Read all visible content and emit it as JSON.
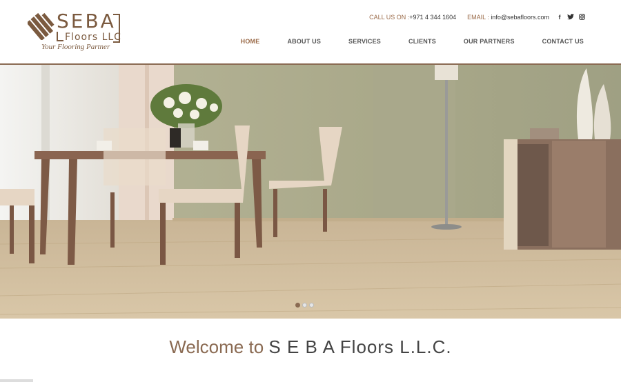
{
  "logo": {
    "word": "SEBA",
    "sub": "Floors LLC",
    "tagline": "Your Flooring Partner"
  },
  "topbar": {
    "call_label": "CALL US ON :",
    "phone": "+971 4 344 1604",
    "email_label": "EMAIL :",
    "email": "info@sebafloors.com",
    "social_icons": [
      "facebook-icon",
      "twitter-icon",
      "instagram-icon"
    ]
  },
  "nav": {
    "items": [
      {
        "label": "HOME",
        "active": true
      },
      {
        "label": "ABOUT US"
      },
      {
        "label": "SERVICES"
      },
      {
        "label": "CLIENTS"
      },
      {
        "label": "OUR PARTNERS"
      },
      {
        "label": "CONTACT US"
      }
    ]
  },
  "slider": {
    "slides": 3,
    "active": 1
  },
  "welcome": {
    "prefix": "Welcome to",
    "brand": "S E B A Floors L.L.C."
  },
  "colors": {
    "accent": "#8a6a52",
    "text": "#444444"
  }
}
